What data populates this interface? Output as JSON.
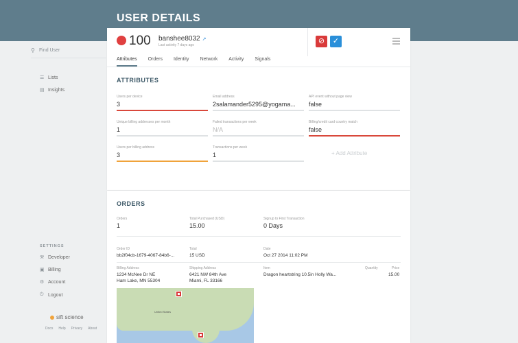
{
  "header": {
    "title": "USER DETAILS"
  },
  "sidebar": {
    "search_placeholder": "Find User",
    "items": [
      {
        "label": "Lists",
        "icon": "list-icon"
      },
      {
        "label": "Insights",
        "icon": "bar-chart-icon"
      }
    ],
    "settings_label": "SETTINGS",
    "settings_items": [
      {
        "label": "Developer",
        "icon": "wrench-icon"
      },
      {
        "label": "Billing",
        "icon": "card-icon"
      },
      {
        "label": "Account",
        "icon": "gear-icon"
      },
      {
        "label": "Logout",
        "icon": "power-icon"
      }
    ],
    "brand": "sift science",
    "footer_links": [
      "Docs",
      "Help",
      "Privacy",
      "About"
    ]
  },
  "user": {
    "score": "100",
    "score_color": "#e04040",
    "username": "banshee8032",
    "last_activity": "Last activity 7 days ago"
  },
  "tabs": [
    "Attributes",
    "Orders",
    "Identity",
    "Network",
    "Activity",
    "Signals"
  ],
  "attributes": {
    "title": "ATTRIBUTES",
    "items": [
      {
        "label": "Users per device",
        "value": "3"
      },
      {
        "label": "Email address",
        "value": "2salamander5295@yogama..."
      },
      {
        "label": "API event without page view",
        "value": "false"
      },
      {
        "label": "Unique billing addresses per month",
        "value": "1"
      },
      {
        "label": "Failed transactions per week",
        "value": "N/A"
      },
      {
        "label": "Billing/credit card country match",
        "value": "false"
      },
      {
        "label": "Users per billing address",
        "value": "3"
      },
      {
        "label": "Transactions per week",
        "value": "1"
      }
    ],
    "add_label": "+ Add Attribute"
  },
  "orders": {
    "title": "ORDERS",
    "summary": [
      {
        "label": "Orders",
        "value": "1"
      },
      {
        "label": "Total Purchased (USD)",
        "value": "15.00"
      },
      {
        "label": "Signup to First Transaction",
        "value": "0 Days"
      }
    ],
    "order": {
      "id_label": "Order ID",
      "id": "bb2f04cb-1679-4067-84b6-...",
      "total_label": "Total",
      "total": "15 USD",
      "date_label": "Date",
      "date": "Oct 27 2014 11:02 PM",
      "billing_label": "Billing Address",
      "billing_line1": "1234 McNee Dr NE",
      "billing_line2": "Ham Lake, MN 55304",
      "shipping_label": "Shipping Address",
      "shipping_line1": "6421 NW 84th Ave",
      "shipping_line2": "Miami, FL 33166",
      "item_label": "Item",
      "item": "Dragon heartstring 10.5in Holly Wa...",
      "quantity_label": "Quantity",
      "quantity": "",
      "price_label": "Price",
      "price": "15.00"
    },
    "map_label": "United States"
  }
}
